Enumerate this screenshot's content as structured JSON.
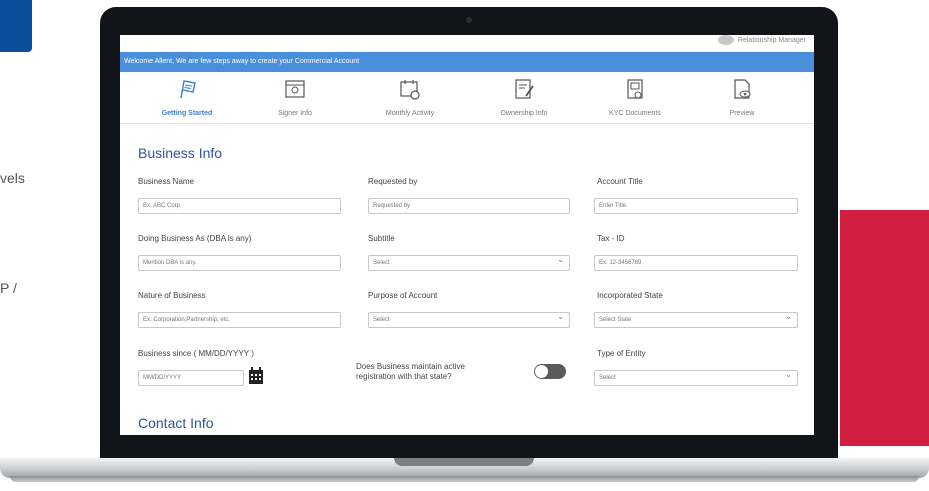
{
  "page_fragments": {
    "line1": "vels",
    "line2": "P /"
  },
  "header": {
    "manager_label": "Relationship Manager"
  },
  "banner": {
    "text": "Welcome Allent, We are few steps away to create your Commercial Account"
  },
  "steps": [
    {
      "label": "Getting Started",
      "icon": "flag-icon",
      "active": true
    },
    {
      "label": "Signer Info",
      "icon": "id-card-icon",
      "active": false
    },
    {
      "label": "Monthly Activity",
      "icon": "calendar-clock-icon",
      "active": false
    },
    {
      "label": "Ownership Info",
      "icon": "document-edit-icon",
      "active": false
    },
    {
      "label": "KYC Documents",
      "icon": "kyc-document-icon",
      "active": false
    },
    {
      "label": "Preview",
      "icon": "preview-icon",
      "active": false
    }
  ],
  "business_info": {
    "title": "Business Info",
    "business_name": {
      "label": "Business Name",
      "placeholder": "Ex. ABC Corp"
    },
    "requested_by": {
      "label": "Requested by",
      "placeholder": "Requested by"
    },
    "account_title": {
      "label": "Account Title",
      "placeholder": "Enter Title."
    },
    "dba": {
      "label": "Doing Business As (DBA is any)",
      "placeholder": "Mention DBA is any."
    },
    "subtitle": {
      "label": "Subtitle",
      "value": "Select"
    },
    "tax_id": {
      "label": "Tax - ID",
      "placeholder": "Ex. 12-3456789"
    },
    "nature": {
      "label": "Nature of Business",
      "placeholder": "Ex. Corporation,Partnership, etc."
    },
    "purpose": {
      "label": "Purpose of Account",
      "value": "Select"
    },
    "inc_state": {
      "label": "Incorporated State",
      "value": "Select State"
    },
    "since": {
      "label": "Business since ( MM/DD/YYYY )",
      "placeholder": "MM/DD/YYYY"
    },
    "registration": {
      "label_line1": "Does Business maintain active",
      "label_line2": "registration with that state?"
    },
    "entity_type": {
      "label": "Type of Entity",
      "value": "Select"
    }
  },
  "contact_info": {
    "title": "Contact Info"
  },
  "colors": {
    "accent": "#4a8fdc",
    "title": "#2f5597",
    "brand_red": "#d21e40",
    "brand_blue": "#0b4f9c"
  }
}
